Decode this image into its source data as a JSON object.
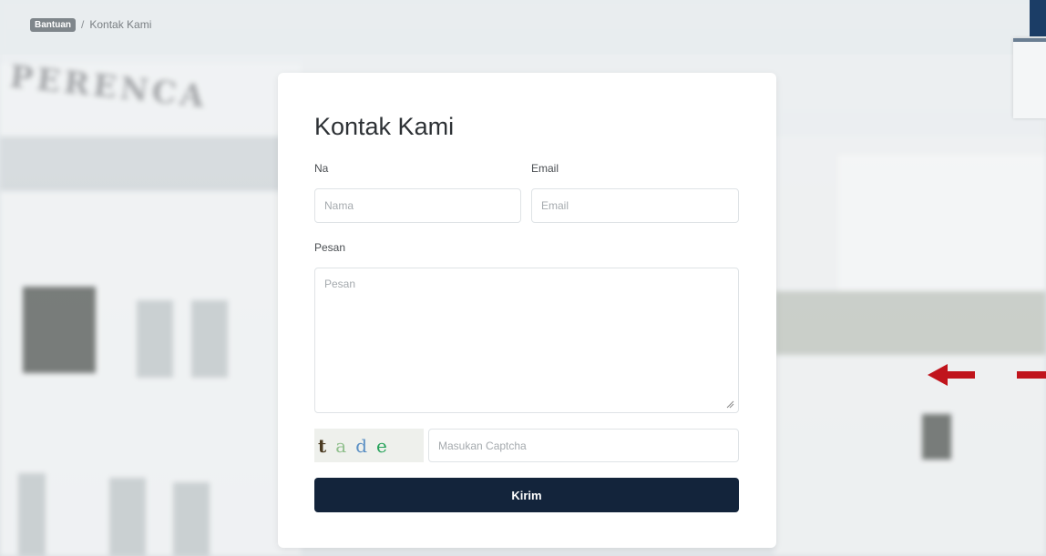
{
  "breadcrumb": {
    "home_label": "Bantuan",
    "separator": "/",
    "current_label": "Kontak Kami"
  },
  "background": {
    "lettering": "PERENCA"
  },
  "form": {
    "title": "Kontak Kami",
    "name_label": "Na",
    "name_placeholder": "Nama",
    "email_label": "Email",
    "email_placeholder": "Email",
    "message_label": "Pesan",
    "message_placeholder": "Pesan",
    "captcha_chars": [
      "t",
      "a",
      "d",
      "e"
    ],
    "captcha_placeholder": "Masukan Captcha",
    "submit_label": "Kirim"
  },
  "colors": {
    "submit_bg": "#13243b",
    "arrow": "#c0141c",
    "corner_accent": "#1b3d66"
  }
}
